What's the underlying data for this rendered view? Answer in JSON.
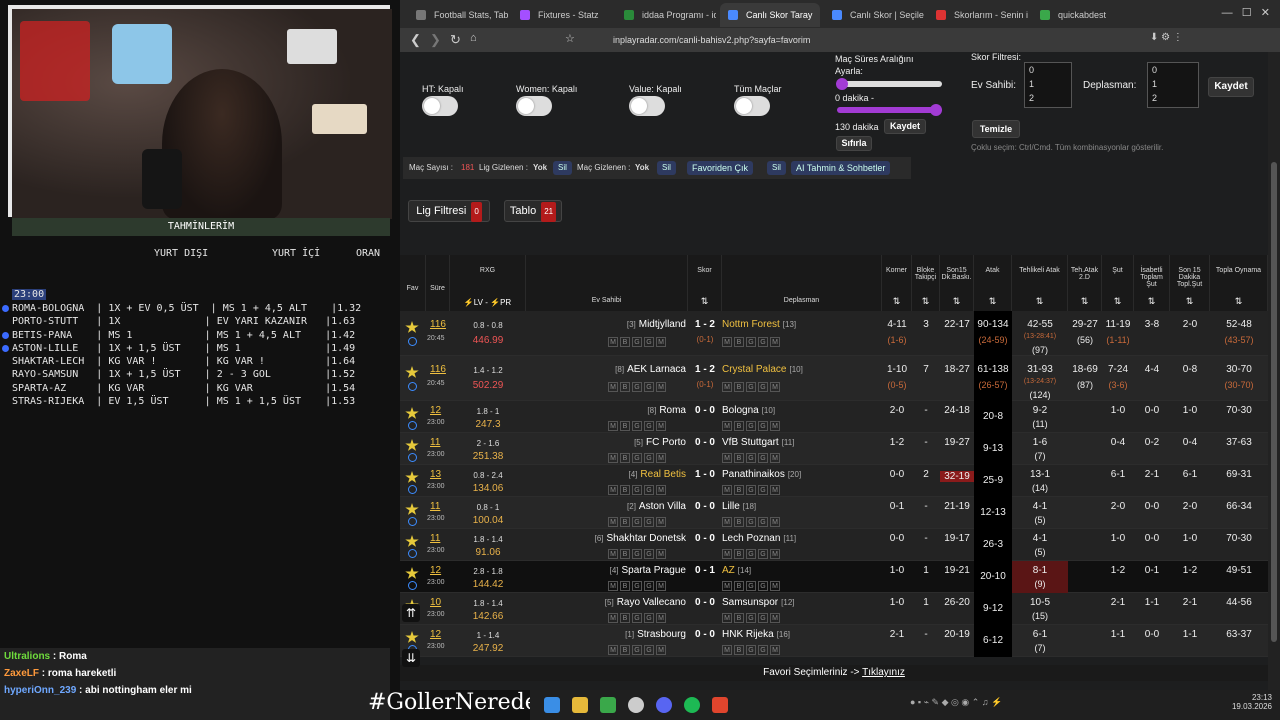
{
  "overlay": {
    "tahmin_title": "TAHMİNLERİM",
    "col_yurtdisi": "YURT DIŞI",
    "col_yurtici": "YURT İÇİ",
    "col_oran": "ORAN",
    "time": "23:00",
    "lines": [
      "ROMA-BOLOGNA  | 1X + EV 0,5 ÜST  | MS 1 + 4,5 ALT    |1.32",
      "PORTO-STUTT   | 1X              | EV YARI KAZANIR   |1.63",
      "BETIS-PANA    | MS 1            | MS 1 + 4,5 ALT    |1.42",
      "ASTON-LILLE   | 1X + 1,5 ÜST    | MS 1              |1.49",
      "",
      "SHAKTAR-LECH  | KG VAR !        | KG VAR !          |1.64",
      "RAYO-SAMSUN   | 1X + 1,5 ÜST    | 2 - 3 GOL         |1.52",
      "SPARTA-AZ     | KG VAR          | KG VAR            |1.54",
      "STRAS-RIJEKA  | EV 1,5 ÜST      | MS 1 + 1,5 ÜST    |1.53"
    ],
    "chat": [
      {
        "user": "Ultralions",
        "msg": "Roma",
        "color": "#6fdc3c"
      },
      {
        "user": "ZaxeLF",
        "msg": "roma hareketli",
        "color": "#ff9a3c"
      },
      {
        "user": "hyperiOnn_239",
        "msg": "abi nottingham eler mi",
        "color": "#6fa8ff"
      }
    ],
    "hashtag": "#GollerNerede"
  },
  "browser": {
    "tabs": [
      "Football Stats, Table",
      "Fixtures - Statz",
      "iddaa Programı - idd",
      "Canlı Skor Taray",
      "Canlı Skor | Seçilen",
      "Skorlarım - Senin iç",
      "quickabdest"
    ],
    "url": "inplayradar.com/canli-bahisv2.php?sayfa=favorim"
  },
  "filters": {
    "ht": "HT: Kapalı",
    "women": "Women: Kapalı",
    "value": "Value: Kapalı",
    "tum": "Tüm Maçlar",
    "sure_title": "Maç Süres Aralığını Ayarla:",
    "min_label": "0 dakika -",
    "max_label": "130 dakika",
    "kaydet": "Kaydet",
    "sifirla": "Sıfırla",
    "skor_title": "Skor Filtresi:",
    "ev": "Ev Sahibi:",
    "dep": "Deplasman:",
    "ev_opts": [
      "0",
      "1",
      "2"
    ],
    "dep_opts": [
      "0",
      "1",
      "2"
    ],
    "kaydet2": "Kaydet",
    "temizle": "Temizle",
    "hint": "Çoklu seçim: Ctrl/Cmd. Tüm kombinasyonlar gösterilir."
  },
  "bar": {
    "mac_sayisi": "Maç Sayısı :",
    "mac_sayisi_val": "181",
    "lig_gizlenen": "Lig Gizlenen :",
    "yok": "Yok",
    "sil": "Sil",
    "mac_gizlenen": "Maç Gizlenen :",
    "favoriden": "Favoriden Çık",
    "ai": "AI Tahmin & Sohbetler"
  },
  "lig_filtresi": "Lig Filtresi",
  "lig_count": "0",
  "tablo": "Tablo",
  "tablo_count": "21",
  "headers": {
    "fav": "Fav",
    "sure": "Süre",
    "rxg": "RXG",
    "lv": "LV",
    "pr": "PR",
    "ev": "Ev Sahibi",
    "skor": "Skor",
    "dep": "Deplasman",
    "korner": "Korner",
    "bloke": "Bloke Takipçi",
    "son15": "Son15 Dk.Baskı.",
    "atak": "Atak",
    "tehlikeli": "Tehlikeli Atak",
    "teh2d": "Teh.Atak 2.D",
    "sut": "Şut",
    "isabetli": "İsabetli Toplam Şut",
    "son15sut": "Son 15 Dakika Topl.Şut",
    "topla": "Topla Oynama"
  },
  "matches": [
    {
      "min": "116",
      "time": "20:45",
      "rxg": "0.8 - 0.8",
      "rxgv": "446.99",
      "home": "Midtjylland",
      "hrank": "[3]",
      "away": "Nottm Forest",
      "arank": "[13]",
      "score": "1 - 2",
      "sub": "(0-1)",
      "korner": "4-11",
      "korner2": "(1-6)",
      "bloke": "3",
      "son15": "22-17",
      "atak": "90-134",
      "atak2": "(24-59)",
      "teh": "42-55",
      "teh2": "(13-28:41)",
      "teh3": "(97)",
      "t2d": "29-27",
      "t2d2": "(56)",
      "sut": "11-19",
      "sut2": "(1-11)",
      "isa": "3-8",
      "s15": "2-0",
      "top": "52-48",
      "top2": "(43-57)"
    },
    {
      "min": "116",
      "time": "20:45",
      "rxg": "1.4 - 1.2",
      "rxgv": "502.29",
      "home": "AEK Larnaca",
      "hrank": "[8]",
      "away": "Crystal Palace",
      "arank": "[10]",
      "score": "1 - 2",
      "sub": "(0-1)",
      "korner": "1-10",
      "korner2": "(0-5)",
      "bloke": "7",
      "son15": "18-27",
      "atak": "61-138",
      "atak2": "(26-57)",
      "teh": "31-93",
      "teh2": "(13-24:37)",
      "teh3": "(124)",
      "t2d": "18-69",
      "t2d2": "(87)",
      "sut": "7-24",
      "sut2": "(3-6)",
      "isa": "4-4",
      "s15": "0-8",
      "top": "30-70",
      "top2": "(30-70)"
    },
    {
      "min": "12",
      "time": "23:00",
      "rxg": "1.8 - 1",
      "rxgv": "247.3",
      "home": "Roma",
      "hrank": "[8]",
      "away": "Bologna",
      "arank": "[10]",
      "score": "0 - 0",
      "korner": "2-0",
      "bloke": "-",
      "son15": "24-18",
      "atak": "20-8",
      "teh": "9-2",
      "teh3": "(11)",
      "sut": "1-0",
      "isa": "0-0",
      "s15": "1-0",
      "top": "70-30"
    },
    {
      "min": "11",
      "time": "23:00",
      "rxg": "2 - 1.6",
      "rxgv": "251.38",
      "home": "FC Porto",
      "hrank": "[5]",
      "away": "VfB Stuttgart",
      "arank": "[11]",
      "score": "0 - 0",
      "korner": "1-2",
      "bloke": "-",
      "son15": "19-27",
      "atak": "9-13",
      "teh": "1-6",
      "teh3": "(7)",
      "sut": "0-4",
      "isa": "0-2",
      "s15": "0-4",
      "top": "37-63"
    },
    {
      "min": "13",
      "time": "23:00",
      "rxg": "0.8 - 2.4",
      "rxgv": "134.06",
      "home": "Real Betis",
      "hrank": "[4]",
      "away": "Panathinaikos",
      "arank": "[20]",
      "score": "1 - 0",
      "korner": "0-0",
      "bloke": "2",
      "son15": "32-19",
      "atak": "25-9",
      "teh": "13-1",
      "teh3": "(14)",
      "sut": "6-1",
      "isa": "2-1",
      "s15": "6-1",
      "top": "69-31"
    },
    {
      "min": "11",
      "time": "23:00",
      "rxg": "0.8 - 1",
      "rxgv": "100.04",
      "home": "Aston Villa",
      "hrank": "[2]",
      "away": "Lille",
      "arank": "[18]",
      "score": "0 - 0",
      "korner": "0-1",
      "bloke": "-",
      "son15": "21-19",
      "atak": "12-13",
      "teh": "4-1",
      "teh3": "(5)",
      "sut": "2-0",
      "isa": "0-0",
      "s15": "2-0",
      "top": "66-34"
    },
    {
      "min": "11",
      "time": "23:00",
      "rxg": "1.8 - 1.4",
      "rxgv": "91.06",
      "home": "Shakhtar Donetsk",
      "hrank": "[6]",
      "away": "Lech Poznan",
      "arank": "[11]",
      "score": "0 - 0",
      "korner": "0-0",
      "bloke": "-",
      "son15": "19-17",
      "atak": "26-3",
      "teh": "4-1",
      "teh3": "(5)",
      "sut": "1-0",
      "isa": "0-0",
      "s15": "1-0",
      "top": "70-30"
    },
    {
      "min": "12",
      "time": "23:00",
      "rxg": "2.8 - 1.8",
      "rxgv": "144.42",
      "home": "Sparta Prague",
      "hrank": "[4]",
      "away": "AZ",
      "arank": "[14]",
      "score": "0 - 1",
      "korner": "1-0",
      "bloke": "1",
      "son15": "19-21",
      "atak": "20-10",
      "teh": "8-1",
      "teh3": "(9)",
      "sut": "1-2",
      "isa": "0-1",
      "s15": "1-2",
      "top": "49-51"
    },
    {
      "min": "10",
      "time": "23:00",
      "rxg": "1.8 - 1.4",
      "rxgv": "142.66",
      "home": "Rayo Vallecano",
      "hrank": "[5]",
      "away": "Samsunspor",
      "arank": "[12]",
      "score": "0 - 0",
      "korner": "1-0",
      "bloke": "1",
      "son15": "26-20",
      "atak": "9-12",
      "teh": "10-5",
      "teh3": "(15)",
      "sut": "2-1",
      "isa": "1-1",
      "s15": "2-1",
      "top": "44-56"
    },
    {
      "min": "12",
      "time": "23:00",
      "rxg": "1 - 1.4",
      "rxgv": "247.92",
      "home": "Strasbourg",
      "hrank": "[1]",
      "away": "HNK Rijeka",
      "arank": "[16]",
      "score": "0 - 0",
      "korner": "2-1",
      "bloke": "-",
      "son15": "20-19",
      "atak": "6-12",
      "teh": "6-1",
      "teh3": "(7)",
      "sut": "1-1",
      "isa": "0-0",
      "s15": "1-1",
      "top": "63-37"
    }
  ],
  "footer": "Favori Seçimleriniz -> ",
  "footer_link": "Tıklayınız",
  "clock": {
    "time": "23:13",
    "date": "19.03.2026"
  }
}
